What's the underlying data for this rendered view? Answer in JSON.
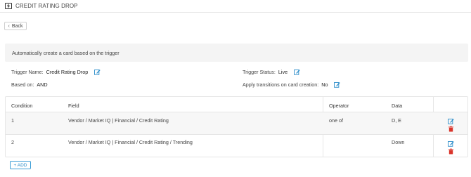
{
  "header": {
    "title": "CREDIT RATING DROP",
    "icon": "lightning-bolt-icon"
  },
  "back_button": {
    "label": "Back",
    "icon": "chevron-left-icon"
  },
  "banner": {
    "text": "Automatically create a card based on the trigger"
  },
  "details": {
    "trigger_name_label": "Trigger Name:",
    "trigger_name_value": "Credit Rating Drop",
    "based_on_label": "Based on:",
    "based_on_value": "AND",
    "trigger_status_label": "Trigger Status:",
    "trigger_status_value": "Live",
    "apply_transitions_label": "Apply transitions on card creation:",
    "apply_transitions_value": "No"
  },
  "table": {
    "headers": [
      "Condition",
      "Field",
      "Operator",
      "Data"
    ],
    "rows": [
      {
        "condition": "1",
        "field": "Vendor / Market IQ | Financial / Credit Rating",
        "operator": "one of",
        "data": "D, E"
      },
      {
        "condition": "2",
        "field": "Vendor / Market IQ | Financial / Credit Rating / Trending",
        "operator": "",
        "data": "Down"
      }
    ]
  },
  "add_button": {
    "label": "+ ADD"
  },
  "colors": {
    "accent": "#2a8cc9",
    "delete": "#d9342b",
    "banner_bg": "#f4f4f4",
    "row_alt": "#f7f7f7"
  }
}
